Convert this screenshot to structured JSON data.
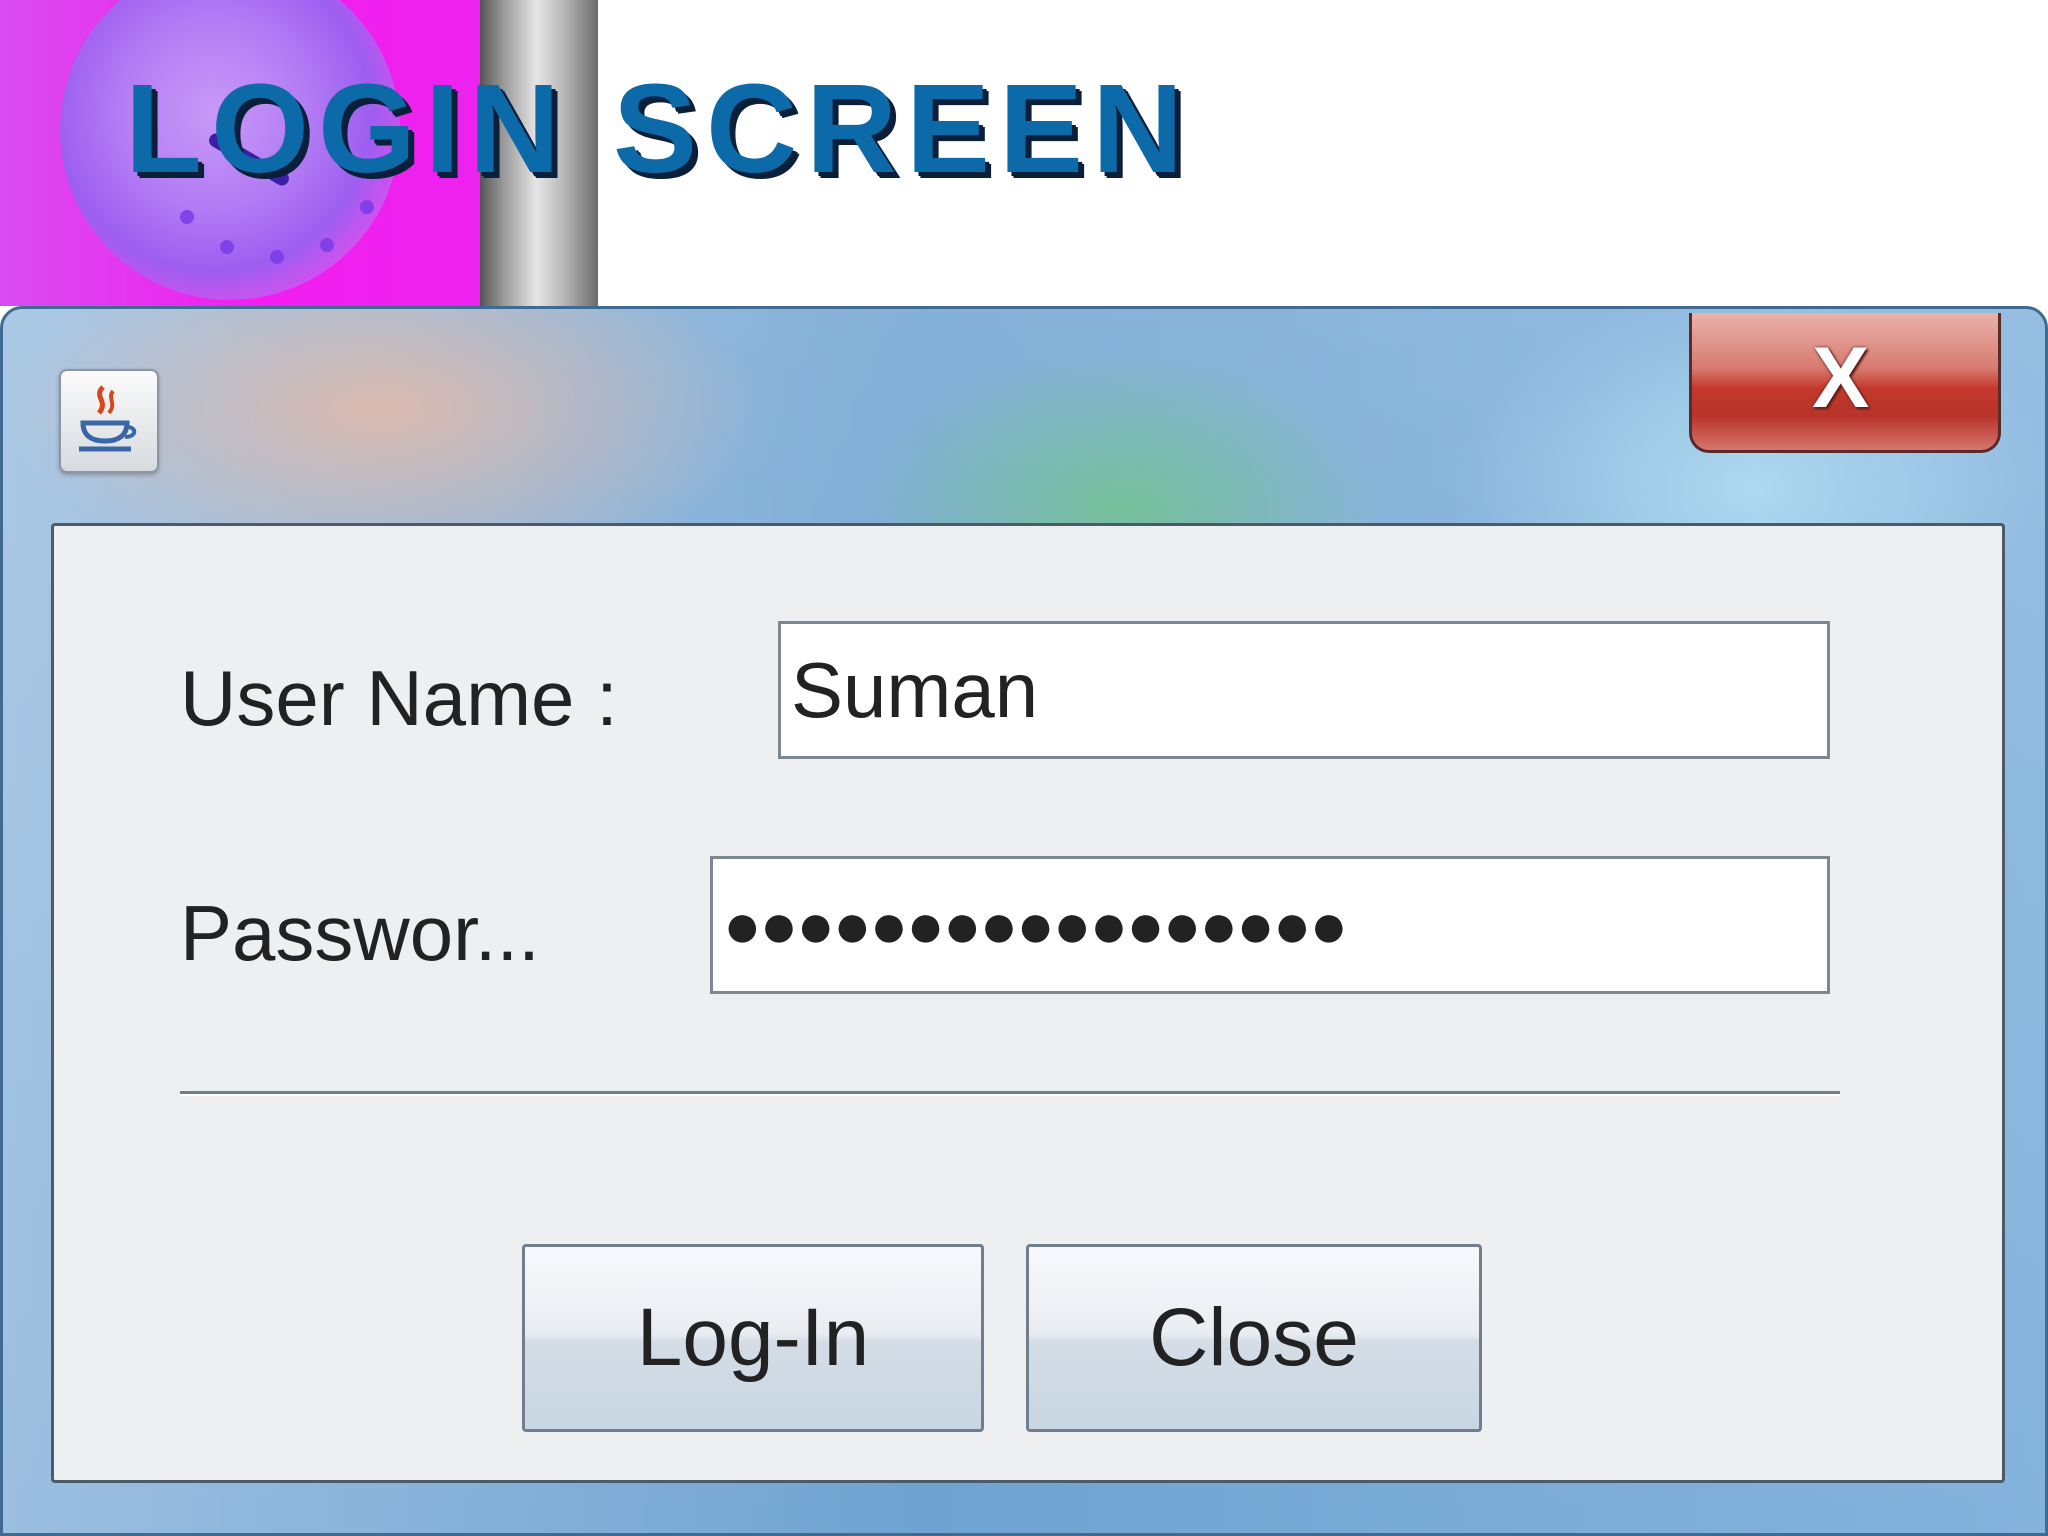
{
  "slide": {
    "title": "LOGIN SCREEN"
  },
  "dialog": {
    "close_glyph": "X",
    "username_label": "User Name :",
    "username_value": "Suman",
    "password_label": "Passwor...",
    "password_mask": "●●●●●●●●●●●●●●●●●",
    "login_button": "Log-In",
    "close_button": "Close"
  },
  "icons": {
    "window_icon": "java-cup-icon",
    "close": "close-icon"
  },
  "colors": {
    "title_blue": "#0c6aa8",
    "close_red": "#c4392c",
    "panel_bg": "#eeeff1"
  }
}
